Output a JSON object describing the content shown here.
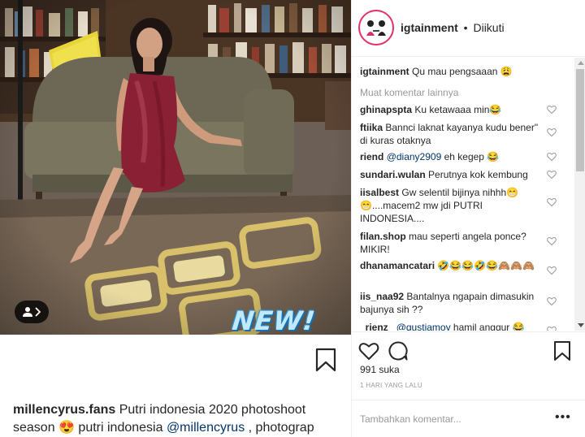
{
  "post": {
    "overlay_text": "NEW!",
    "caption_user": "millencyrus.fans",
    "caption_text_1": " Putri indonesia 2020 photoshoot season ",
    "caption_emoji": "😍",
    "caption_text_2": " putri indonesia ",
    "caption_mention": "@millencyrus",
    "caption_text_3": " , photograp"
  },
  "header": {
    "username": "igtainment",
    "separator": "•",
    "follow_label": "Diikuti"
  },
  "owner_comment": {
    "user": "igtainment",
    "text": "Qu mau pengsaaan 😩"
  },
  "load_more_label": "Muat komentar lainnya",
  "comments": [
    {
      "user": "ghinapspta",
      "text": "Ku ketawaaa min😂"
    },
    {
      "user": "ftiika",
      "text": "Bannci laknat kayanya kudu bener\" di kuras otaknya"
    },
    {
      "user": "riend",
      "mention": "@diany2909",
      "text": " eh kegep 😂"
    },
    {
      "user": "sundari.wulan",
      "text": "Perutnya kok kembung"
    },
    {
      "user": "iisalbest",
      "text": "Gw selentil bijinya nihhh😁😁....macem2 mw jdi PUTRI INDONESIA...."
    },
    {
      "user": "filan.shop",
      "text": "mau seperti angela ponce? MIKIR!"
    },
    {
      "user": "dhanamancatari",
      "text": "🤣😂😂🤣😂🙈🙈🙈"
    },
    {
      "user": "iis_naa92",
      "text": "Bantalnya ngapain dimasukin bajunya sih ??"
    },
    {
      "user": "_rienz_",
      "mention": "@qustiamoy",
      "text": " hamil anggur 😂"
    }
  ],
  "likes": "991 suka",
  "timestamp": "1 HARI YANG LALU",
  "add_comment_placeholder": "Tambahkan komentar...",
  "more_label": "•••",
  "colors": {
    "avatar_ring": "#e1306c",
    "mention": "#003569",
    "muted": "#999999",
    "border": "#efefef"
  }
}
